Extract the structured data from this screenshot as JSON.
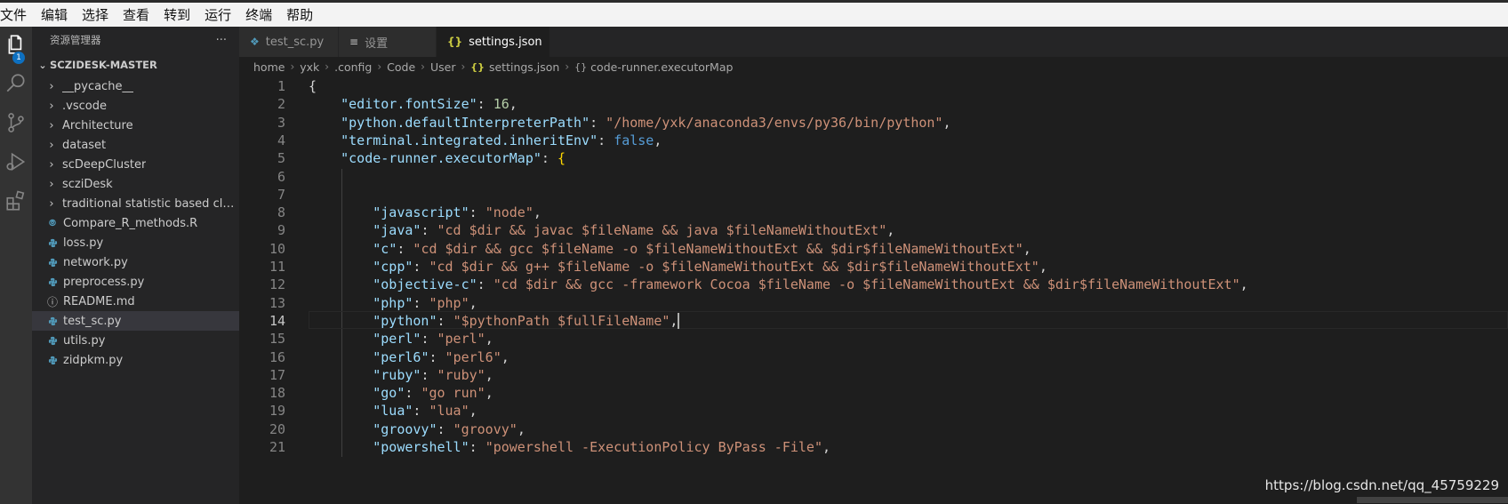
{
  "menubar": {
    "items": [
      "文件",
      "编辑",
      "选择",
      "查看",
      "转到",
      "运行",
      "终端",
      "帮助"
    ]
  },
  "activity_bar": {
    "icons": [
      "explorer-icon",
      "search-icon",
      "source-control-icon",
      "run-debug-icon",
      "extensions-icon"
    ],
    "explorer_badge": "1"
  },
  "sidebar": {
    "title": "资源管理器",
    "more": "···",
    "folder": "SCZIDESK-MASTER",
    "items": [
      {
        "label": "__pycache__",
        "type": "folder"
      },
      {
        "label": ".vscode",
        "type": "folder"
      },
      {
        "label": "Architecture",
        "type": "folder"
      },
      {
        "label": "dataset",
        "type": "folder"
      },
      {
        "label": "scDeepCluster",
        "type": "folder"
      },
      {
        "label": "scziDesk",
        "type": "folder"
      },
      {
        "label": "traditional statistic based clust...",
        "type": "folder"
      },
      {
        "label": "Compare_R_methods.R",
        "type": "r"
      },
      {
        "label": "loss.py",
        "type": "py"
      },
      {
        "label": "network.py",
        "type": "py"
      },
      {
        "label": "preprocess.py",
        "type": "py"
      },
      {
        "label": "README.md",
        "type": "info"
      },
      {
        "label": "test_sc.py",
        "type": "py",
        "selected": true
      },
      {
        "label": "utils.py",
        "type": "py"
      },
      {
        "label": "zidpkm.py",
        "type": "py"
      }
    ]
  },
  "tabs": [
    {
      "label": "test_sc.py",
      "icon": "python-file-icon",
      "active": false
    },
    {
      "label": "设置",
      "icon": "settings-list-icon",
      "active": false
    },
    {
      "label": "settings.json",
      "icon": "json-braces-icon",
      "active": true,
      "dirty": true
    }
  ],
  "breadcrumb": {
    "parts": [
      "home",
      "yxk",
      ".config",
      "Code",
      "User"
    ],
    "file": "settings.json",
    "symbol": "code-runner.executorMap"
  },
  "editor": {
    "current_line": 14,
    "lines": [
      {
        "n": "1",
        "indent": 0,
        "kind": "open"
      },
      {
        "n": "2",
        "indent": 1,
        "key": "editor.fontSize",
        "num": "16"
      },
      {
        "n": "3",
        "indent": 1,
        "key": "python.defaultInterpreterPath",
        "str": "/home/yxk/anaconda3/envs/py36/bin/python"
      },
      {
        "n": "4",
        "indent": 1,
        "key": "terminal.integrated.inheritEnv",
        "kw": "false"
      },
      {
        "n": "5",
        "indent": 1,
        "key": "code-runner.executorMap",
        "kind": "objopen"
      },
      {
        "n": "6",
        "indent": 0,
        "kind": "blank"
      },
      {
        "n": "7",
        "indent": 0,
        "kind": "blank"
      },
      {
        "n": "8",
        "indent": 2,
        "key": "javascript",
        "str": "node"
      },
      {
        "n": "9",
        "indent": 2,
        "key": "java",
        "str": "cd $dir && javac $fileName && java $fileNameWithoutExt"
      },
      {
        "n": "10",
        "indent": 2,
        "key": "c",
        "str": "cd $dir && gcc $fileName -o $fileNameWithoutExt && $dir$fileNameWithoutExt"
      },
      {
        "n": "11",
        "indent": 2,
        "key": "cpp",
        "str": "cd $dir && g++ $fileName -o $fileNameWithoutExt && $dir$fileNameWithoutExt"
      },
      {
        "n": "12",
        "indent": 2,
        "key": "objective-c",
        "str": "cd $dir && gcc -framework Cocoa $fileName -o $fileNameWithoutExt && $dir$fileNameWithoutExt"
      },
      {
        "n": "13",
        "indent": 2,
        "key": "php",
        "str": "php"
      },
      {
        "n": "14",
        "indent": 2,
        "key": "python",
        "str": "$pythonPath $fullFileName",
        "cursor": true
      },
      {
        "n": "15",
        "indent": 2,
        "key": "perl",
        "str": "perl"
      },
      {
        "n": "16",
        "indent": 2,
        "key": "perl6",
        "str": "perl6"
      },
      {
        "n": "17",
        "indent": 2,
        "key": "ruby",
        "str": "ruby"
      },
      {
        "n": "18",
        "indent": 2,
        "key": "go",
        "str": "go run"
      },
      {
        "n": "19",
        "indent": 2,
        "key": "lua",
        "str": "lua"
      },
      {
        "n": "20",
        "indent": 2,
        "key": "groovy",
        "str": "groovy"
      },
      {
        "n": "21",
        "indent": 2,
        "key": "powershell",
        "str": "powershell -ExecutionPolicy ByPass -File"
      }
    ]
  },
  "watermark": "https://blog.csdn.net/qq_45759229"
}
